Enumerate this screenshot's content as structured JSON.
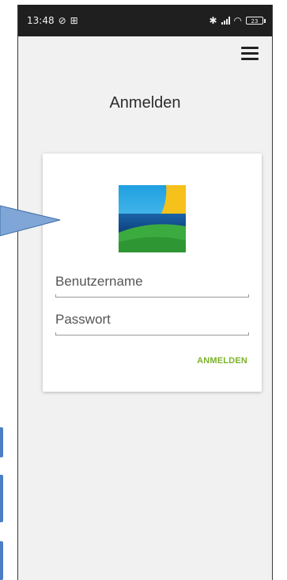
{
  "status_bar": {
    "time": "13:48",
    "icons": [
      "location-off-icon",
      "grid-icon",
      "bluetooth-icon",
      "signal-icon",
      "wifi-icon",
      "battery-icon"
    ],
    "battery_level": "23"
  },
  "header": {
    "menu_icon": "hamburger-menu-icon"
  },
  "page": {
    "title": "Anmelden"
  },
  "login_card": {
    "logo": "app-logo-landscape",
    "username_placeholder": "Benutzername",
    "password_placeholder": "Passwort",
    "login_button_label": "ANMELDEN"
  },
  "colors": {
    "accent_green": "#7cb22a",
    "overlay_blue": "#4a7fc4",
    "status_bar_bg": "#1f1f1f",
    "app_bg": "#f1f1f1"
  }
}
